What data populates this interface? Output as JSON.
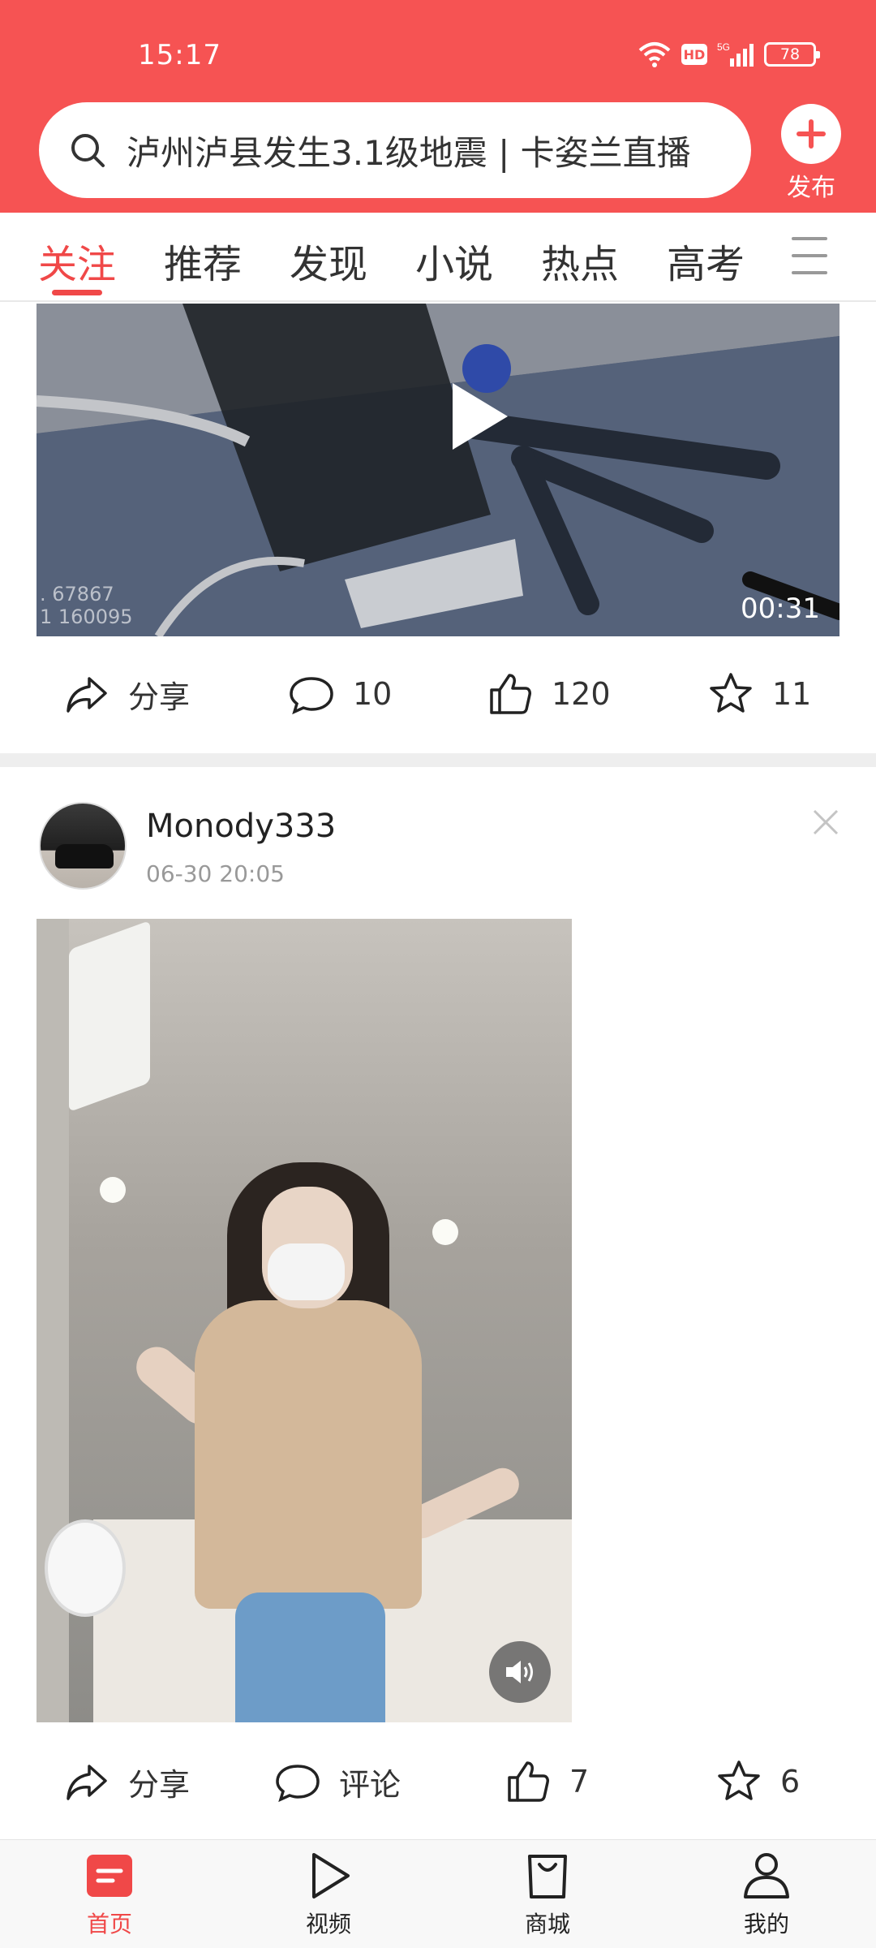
{
  "status_bar": {
    "time": "15:17",
    "hd": "HD",
    "network": "5G",
    "battery": "78"
  },
  "search": {
    "text": "泸州泸县发生3.1级地震 | 卡姿兰直播"
  },
  "publish": {
    "label": "发布"
  },
  "tabs": [
    {
      "label": "关注",
      "active": true
    },
    {
      "label": "推荐",
      "active": false
    },
    {
      "label": "发现",
      "active": false
    },
    {
      "label": "小说",
      "active": false
    },
    {
      "label": "热点",
      "active": false
    },
    {
      "label": "高考",
      "active": false
    }
  ],
  "post1": {
    "duration": "00:31",
    "overlay_text": [
      ". 67867",
      "1 160095"
    ],
    "actions": {
      "share": "分享",
      "comments": "10",
      "likes": "120",
      "favorites": "11"
    }
  },
  "post2": {
    "author": "Monody333",
    "time": "06-30 20:05",
    "actions": {
      "share": "分享",
      "comment": "评论",
      "likes": "7",
      "favorites": "6"
    }
  },
  "bottom_nav": [
    {
      "label": "首页",
      "icon": "home-icon",
      "active": true
    },
    {
      "label": "视频",
      "icon": "video-icon",
      "active": false
    },
    {
      "label": "商城",
      "icon": "shop-bag-icon",
      "active": false
    },
    {
      "label": "我的",
      "icon": "profile-icon",
      "active": false
    }
  ],
  "colors": {
    "brand_red": "#f65353",
    "active_tab": "#f04848"
  }
}
